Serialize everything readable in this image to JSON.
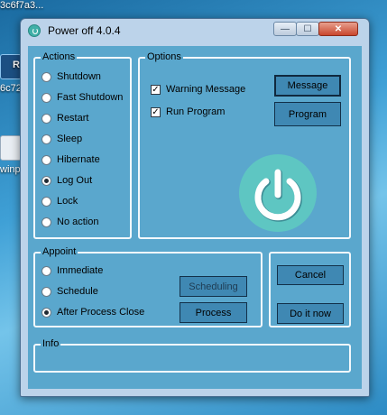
{
  "desktop": {
    "top_text": "3c6f7a3...",
    "label_1": "R",
    "label_2": "6c72",
    "label_3": "winpl"
  },
  "window": {
    "title": "Power off 4.0.4",
    "controls": {
      "minimize": "—",
      "maximize": "☐",
      "close": "✕"
    }
  },
  "actions": {
    "title": "Actions",
    "options": [
      "Shutdown",
      "Fast Shutdown",
      "Restart",
      "Sleep",
      "Hibernate",
      "Log Out",
      "Lock",
      "No action"
    ],
    "selected": "Log Out"
  },
  "options": {
    "title": "Options",
    "warning_message": "Warning Message",
    "run_program": "Run Program",
    "message_button": "Message",
    "program_button": "Program",
    "colors": {
      "power_circle": "#5ec6c2",
      "power_symbol": "#ffffff",
      "power_bg": "#3c8d95"
    }
  },
  "appoint": {
    "title": "Appoint",
    "options": [
      "Immediate",
      "Schedule",
      "After Process Close"
    ],
    "selected": "After Process Close",
    "scheduling_button": "Scheduling",
    "process_button": "Process"
  },
  "buttons": {
    "cancel": "Cancel",
    "do_it_now": "Do it now"
  },
  "info": {
    "title": "Info"
  }
}
